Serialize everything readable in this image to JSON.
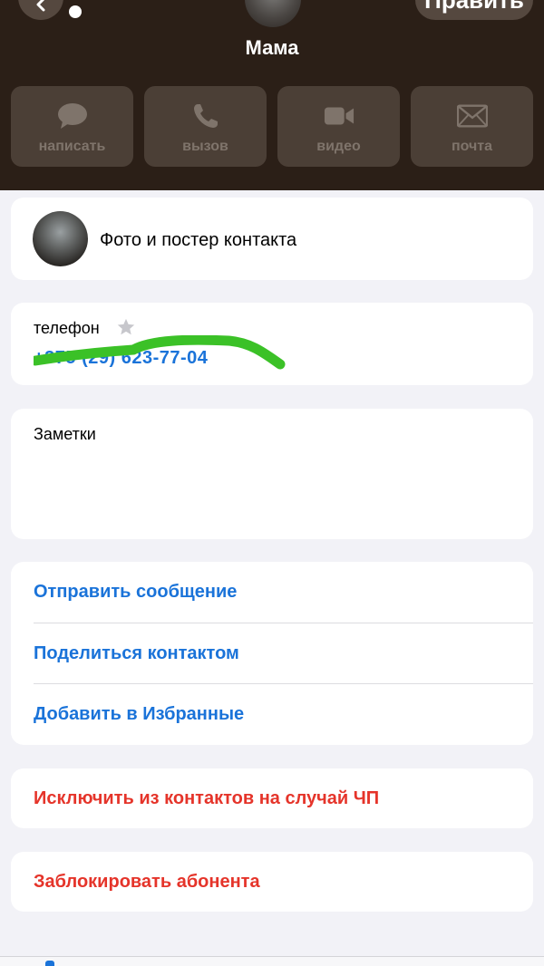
{
  "header": {
    "contact_name": "Мама",
    "edit_label": "Править",
    "actions": [
      {
        "label": "написать",
        "icon": "message-bubble-icon"
      },
      {
        "label": "вызов",
        "icon": "phone-icon"
      },
      {
        "label": "видео",
        "icon": "video-camera-icon"
      },
      {
        "label": "почта",
        "icon": "mail-envelope-icon"
      }
    ]
  },
  "poster": {
    "label": "Фото и постер контакта"
  },
  "phone": {
    "title": "телефон",
    "number": "+375 (29) 623-77-04"
  },
  "notes": {
    "label": "Заметки"
  },
  "menu": {
    "items": [
      {
        "label": "Отправить сообщение"
      },
      {
        "label": "Поделиться контактом"
      },
      {
        "label": "Добавить в Избранные"
      }
    ]
  },
  "emergency": {
    "label": "Исключить из контактов на случай ЧП"
  },
  "block": {
    "label": "Заблокировать абонента"
  },
  "colors": {
    "header_bg": "#2b1f17",
    "link_blue": "#1a73d9",
    "danger_red": "#e5342a",
    "scribble_green": "#3bc127"
  }
}
